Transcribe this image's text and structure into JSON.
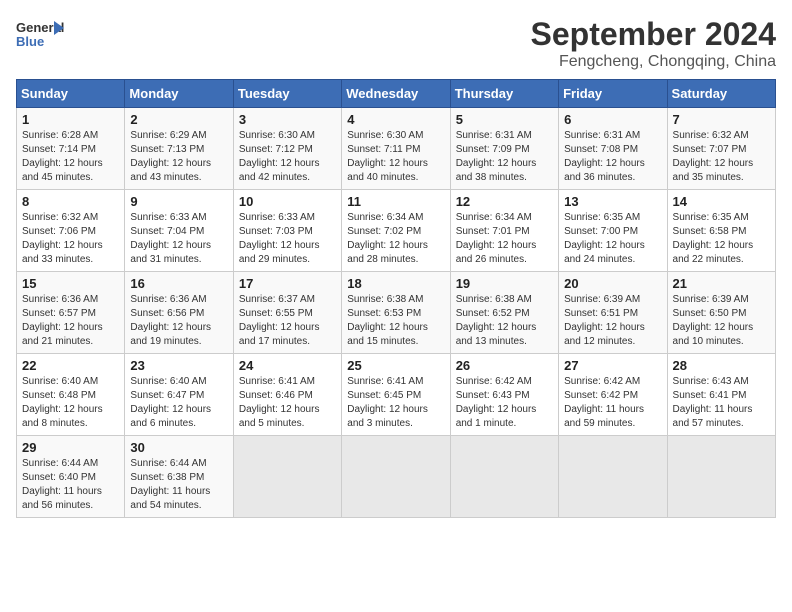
{
  "header": {
    "logo_line1": "General",
    "logo_line2": "Blue",
    "title": "September 2024",
    "subtitle": "Fengcheng, Chongqing, China"
  },
  "calendar": {
    "headers": [
      "Sunday",
      "Monday",
      "Tuesday",
      "Wednesday",
      "Thursday",
      "Friday",
      "Saturday"
    ],
    "rows": [
      [
        {
          "day": "1",
          "sunrise": "Sunrise: 6:28 AM",
          "sunset": "Sunset: 7:14 PM",
          "daylight": "Daylight: 12 hours and 45 minutes."
        },
        {
          "day": "2",
          "sunrise": "Sunrise: 6:29 AM",
          "sunset": "Sunset: 7:13 PM",
          "daylight": "Daylight: 12 hours and 43 minutes."
        },
        {
          "day": "3",
          "sunrise": "Sunrise: 6:30 AM",
          "sunset": "Sunset: 7:12 PM",
          "daylight": "Daylight: 12 hours and 42 minutes."
        },
        {
          "day": "4",
          "sunrise": "Sunrise: 6:30 AM",
          "sunset": "Sunset: 7:11 PM",
          "daylight": "Daylight: 12 hours and 40 minutes."
        },
        {
          "day": "5",
          "sunrise": "Sunrise: 6:31 AM",
          "sunset": "Sunset: 7:09 PM",
          "daylight": "Daylight: 12 hours and 38 minutes."
        },
        {
          "day": "6",
          "sunrise": "Sunrise: 6:31 AM",
          "sunset": "Sunset: 7:08 PM",
          "daylight": "Daylight: 12 hours and 36 minutes."
        },
        {
          "day": "7",
          "sunrise": "Sunrise: 6:32 AM",
          "sunset": "Sunset: 7:07 PM",
          "daylight": "Daylight: 12 hours and 35 minutes."
        }
      ],
      [
        {
          "day": "8",
          "sunrise": "Sunrise: 6:32 AM",
          "sunset": "Sunset: 7:06 PM",
          "daylight": "Daylight: 12 hours and 33 minutes."
        },
        {
          "day": "9",
          "sunrise": "Sunrise: 6:33 AM",
          "sunset": "Sunset: 7:04 PM",
          "daylight": "Daylight: 12 hours and 31 minutes."
        },
        {
          "day": "10",
          "sunrise": "Sunrise: 6:33 AM",
          "sunset": "Sunset: 7:03 PM",
          "daylight": "Daylight: 12 hours and 29 minutes."
        },
        {
          "day": "11",
          "sunrise": "Sunrise: 6:34 AM",
          "sunset": "Sunset: 7:02 PM",
          "daylight": "Daylight: 12 hours and 28 minutes."
        },
        {
          "day": "12",
          "sunrise": "Sunrise: 6:34 AM",
          "sunset": "Sunset: 7:01 PM",
          "daylight": "Daylight: 12 hours and 26 minutes."
        },
        {
          "day": "13",
          "sunrise": "Sunrise: 6:35 AM",
          "sunset": "Sunset: 7:00 PM",
          "daylight": "Daylight: 12 hours and 24 minutes."
        },
        {
          "day": "14",
          "sunrise": "Sunrise: 6:35 AM",
          "sunset": "Sunset: 6:58 PM",
          "daylight": "Daylight: 12 hours and 22 minutes."
        }
      ],
      [
        {
          "day": "15",
          "sunrise": "Sunrise: 6:36 AM",
          "sunset": "Sunset: 6:57 PM",
          "daylight": "Daylight: 12 hours and 21 minutes."
        },
        {
          "day": "16",
          "sunrise": "Sunrise: 6:36 AM",
          "sunset": "Sunset: 6:56 PM",
          "daylight": "Daylight: 12 hours and 19 minutes."
        },
        {
          "day": "17",
          "sunrise": "Sunrise: 6:37 AM",
          "sunset": "Sunset: 6:55 PM",
          "daylight": "Daylight: 12 hours and 17 minutes."
        },
        {
          "day": "18",
          "sunrise": "Sunrise: 6:38 AM",
          "sunset": "Sunset: 6:53 PM",
          "daylight": "Daylight: 12 hours and 15 minutes."
        },
        {
          "day": "19",
          "sunrise": "Sunrise: 6:38 AM",
          "sunset": "Sunset: 6:52 PM",
          "daylight": "Daylight: 12 hours and 13 minutes."
        },
        {
          "day": "20",
          "sunrise": "Sunrise: 6:39 AM",
          "sunset": "Sunset: 6:51 PM",
          "daylight": "Daylight: 12 hours and 12 minutes."
        },
        {
          "day": "21",
          "sunrise": "Sunrise: 6:39 AM",
          "sunset": "Sunset: 6:50 PM",
          "daylight": "Daylight: 12 hours and 10 minutes."
        }
      ],
      [
        {
          "day": "22",
          "sunrise": "Sunrise: 6:40 AM",
          "sunset": "Sunset: 6:48 PM",
          "daylight": "Daylight: 12 hours and 8 minutes."
        },
        {
          "day": "23",
          "sunrise": "Sunrise: 6:40 AM",
          "sunset": "Sunset: 6:47 PM",
          "daylight": "Daylight: 12 hours and 6 minutes."
        },
        {
          "day": "24",
          "sunrise": "Sunrise: 6:41 AM",
          "sunset": "Sunset: 6:46 PM",
          "daylight": "Daylight: 12 hours and 5 minutes."
        },
        {
          "day": "25",
          "sunrise": "Sunrise: 6:41 AM",
          "sunset": "Sunset: 6:45 PM",
          "daylight": "Daylight: 12 hours and 3 minutes."
        },
        {
          "day": "26",
          "sunrise": "Sunrise: 6:42 AM",
          "sunset": "Sunset: 6:43 PM",
          "daylight": "Daylight: 12 hours and 1 minute."
        },
        {
          "day": "27",
          "sunrise": "Sunrise: 6:42 AM",
          "sunset": "Sunset: 6:42 PM",
          "daylight": "Daylight: 11 hours and 59 minutes."
        },
        {
          "day": "28",
          "sunrise": "Sunrise: 6:43 AM",
          "sunset": "Sunset: 6:41 PM",
          "daylight": "Daylight: 11 hours and 57 minutes."
        }
      ],
      [
        {
          "day": "29",
          "sunrise": "Sunrise: 6:44 AM",
          "sunset": "Sunset: 6:40 PM",
          "daylight": "Daylight: 11 hours and 56 minutes."
        },
        {
          "day": "30",
          "sunrise": "Sunrise: 6:44 AM",
          "sunset": "Sunset: 6:38 PM",
          "daylight": "Daylight: 11 hours and 54 minutes."
        },
        null,
        null,
        null,
        null,
        null
      ]
    ]
  }
}
